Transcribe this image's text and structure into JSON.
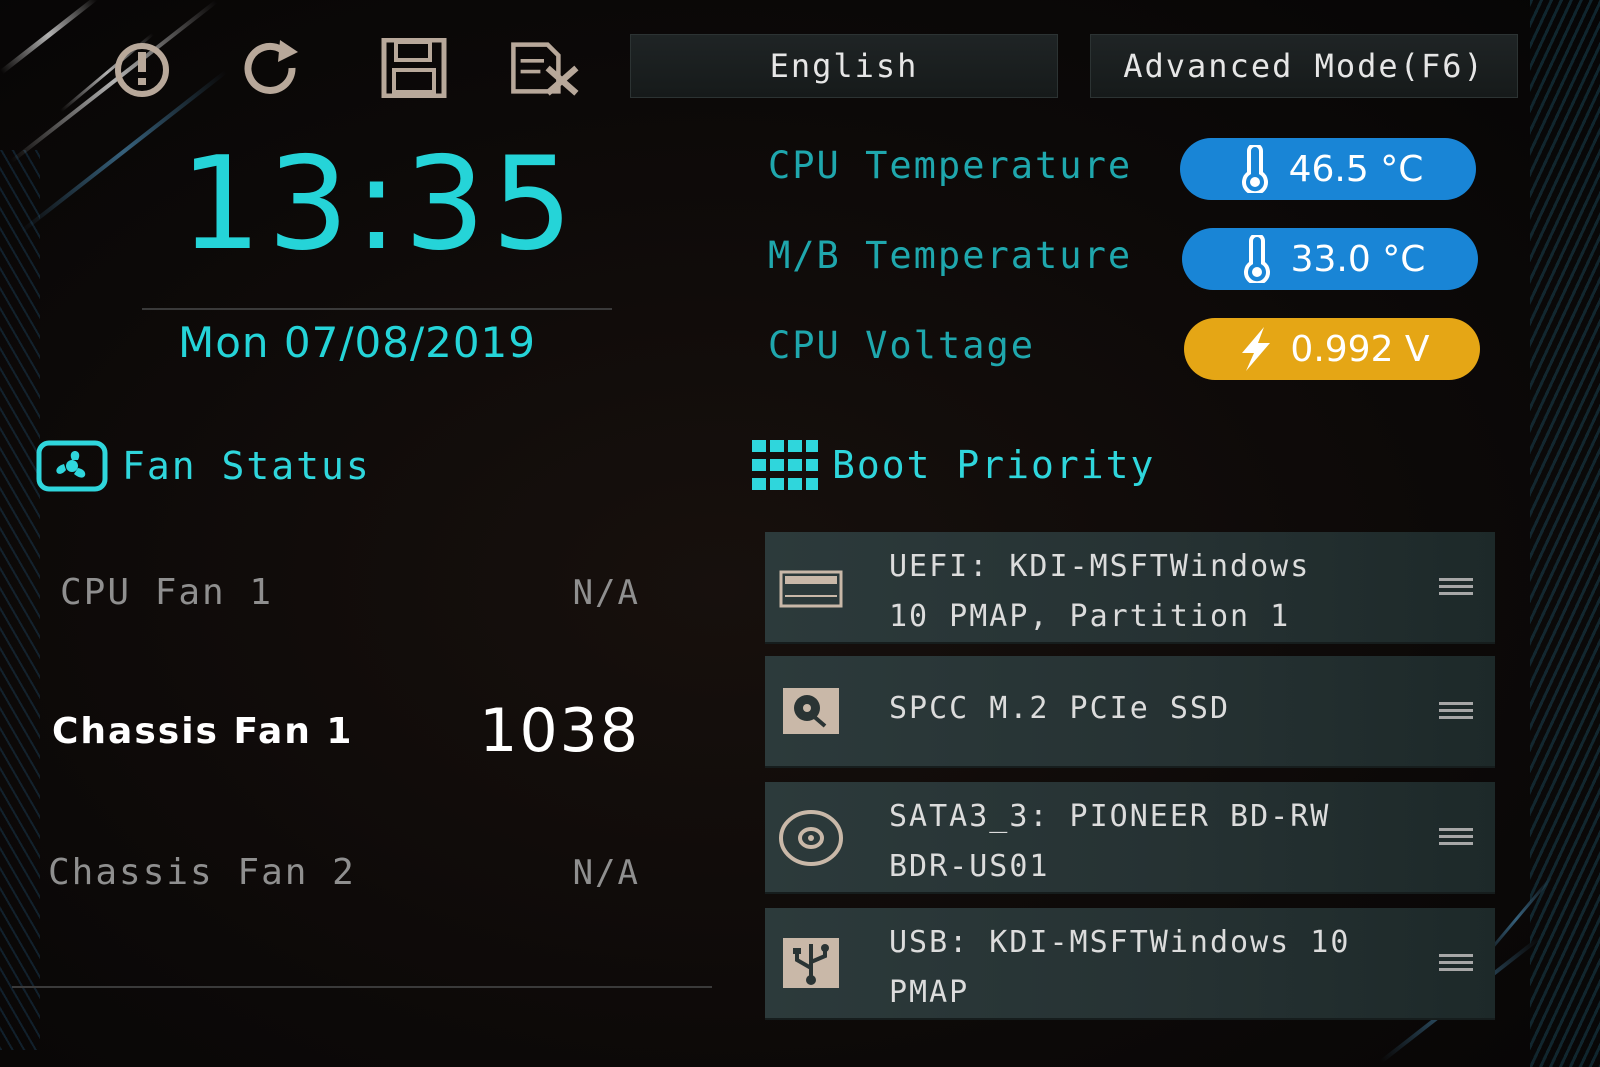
{
  "toolbar": {
    "icons": [
      "exit-icon",
      "reset-icon",
      "save-icon",
      "discard-icon"
    ],
    "language_label": "English",
    "advanced_mode_label": "Advanced Mode(F6)"
  },
  "clock": {
    "time": "13:35",
    "date": "Mon 07/08/2019"
  },
  "sensors": [
    {
      "label": "CPU Temperature",
      "value": "46.5 °C",
      "icon": "thermometer-icon",
      "color": "#1985d6"
    },
    {
      "label": "M/B Temperature",
      "value": "33.0 °C",
      "icon": "thermometer-icon",
      "color": "#1985d6"
    },
    {
      "label": "CPU Voltage",
      "value": "0.992 V",
      "icon": "lightning-icon",
      "color": "#e5a615"
    }
  ],
  "fan_status": {
    "title": "Fan Status",
    "fans": [
      {
        "name": "CPU Fan 1",
        "value": "N/A",
        "active": false
      },
      {
        "name": "Chassis Fan 1",
        "value": "1038",
        "active": true
      },
      {
        "name": "Chassis Fan 2",
        "value": "N/A",
        "active": false
      }
    ]
  },
  "boot_priority": {
    "title": "Boot Priority",
    "items": [
      {
        "label": "UEFI: KDI-MSFTWindows\n 10 PMAP, Partition 1",
        "icon": "disk-partition-icon"
      },
      {
        "label": "SPCC M.2 PCIe SSD",
        "icon": "ssd-icon"
      },
      {
        "label": "SATA3_3: PIONEER BD-RW\n  BDR-US01",
        "icon": "optical-disc-icon"
      },
      {
        "label": "USB: KDI-MSFTWindows 10\n PMAP",
        "icon": "usb-icon"
      }
    ]
  },
  "colors": {
    "accent_cyan": "#25d4d8",
    "temp_blue": "#1985d6",
    "voltage_orange": "#e5a615"
  }
}
